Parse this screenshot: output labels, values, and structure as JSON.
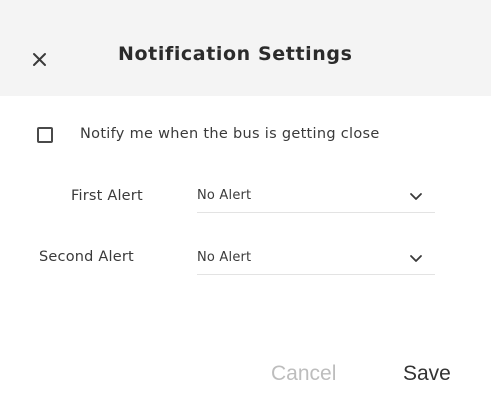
{
  "header": {
    "title": "Notification Settings",
    "close_icon": "close-icon"
  },
  "notify": {
    "checked": false,
    "label": "Notify me when the bus is getting close"
  },
  "alerts": [
    {
      "label": "First Alert",
      "value": "No Alert",
      "icon": "chevron-down-icon"
    },
    {
      "label": "Second Alert",
      "value": "No Alert",
      "icon": "chevron-down-icon"
    }
  ],
  "actions": {
    "cancel_label": "Cancel",
    "save_label": "Save"
  },
  "colors": {
    "header_bg": "#f4f4f4",
    "body_bg": "#ffffff",
    "text": "#3a3a3a",
    "cancel_text": "#bdbdbd",
    "save_text": "#333333"
  }
}
